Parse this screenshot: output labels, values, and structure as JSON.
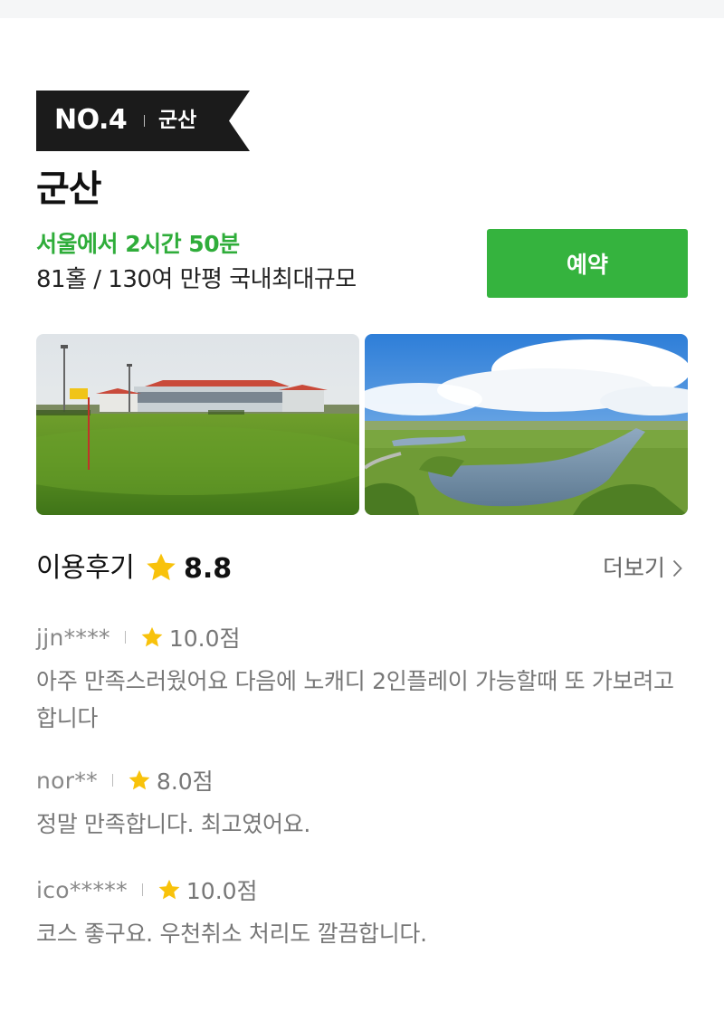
{
  "rank": {
    "number": "NO.4",
    "region": "군산"
  },
  "course": {
    "title": "군산",
    "travel_time": "서울에서 2시간 50분",
    "description": "81홀 / 130여 만평 국내최대규모"
  },
  "reserve_button": {
    "label": "예약"
  },
  "photos": [
    {
      "subject": "clubhouse-and-green"
    },
    {
      "subject": "lake-and-fairways"
    }
  ],
  "reviews_section": {
    "title": "이용후기",
    "rating": "8.8",
    "more_label": "더보기"
  },
  "reviews": [
    {
      "user": "jjn****",
      "score": "10.0점",
      "text": "아주 만족스러웠어요 다음에 노캐디 2인플레이 가능할때 또 가보려고합니다"
    },
    {
      "user": "nor**",
      "score": "8.0점",
      "text": "정말 만족합니다. 최고였어요."
    },
    {
      "user": "ico*****",
      "score": "10.0점",
      "text": "코스 좋구요. 우천취소 처리도 깔끔합니다."
    }
  ],
  "colors": {
    "accent_green": "#35b33e",
    "travel_text_green": "#2fad3a",
    "badge_black": "#1b1b1b",
    "star_yellow": "#f8c20b"
  },
  "icons": {
    "star": "star-icon",
    "more": "chevron-right-icon"
  }
}
